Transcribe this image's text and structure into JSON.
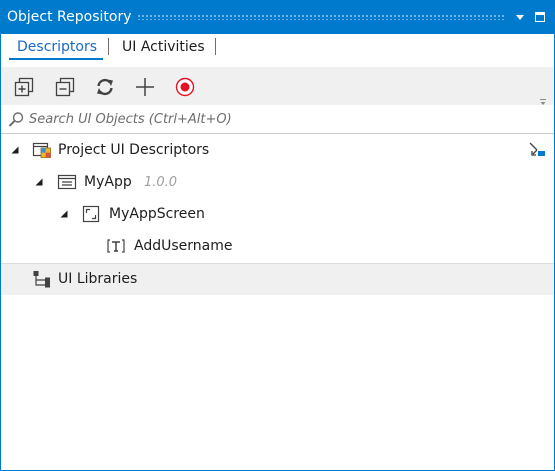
{
  "window": {
    "title": "Object Repository"
  },
  "tabs": [
    {
      "label": "Descriptors",
      "active": true
    },
    {
      "label": "UI Activities",
      "active": false
    }
  ],
  "toolbar": {
    "buttons": [
      {
        "icon": "expand-all-icon"
      },
      {
        "icon": "collapse-all-icon"
      },
      {
        "icon": "refresh-icon"
      },
      {
        "icon": "add-icon"
      },
      {
        "icon": "record-icon"
      }
    ]
  },
  "search": {
    "placeholder": "Search UI Objects (Ctrl+Alt+O)",
    "value": ""
  },
  "tree": {
    "project": {
      "label": "Project UI Descriptors",
      "icon": "project-descriptors-icon",
      "expanded": true
    },
    "app": {
      "label": "MyApp",
      "version": "1.0.0",
      "icon": "application-icon",
      "expanded": true
    },
    "screen": {
      "label": "MyAppScreen",
      "icon": "screen-icon",
      "expanded": true
    },
    "element": {
      "label": "AddUsername",
      "icon": "text-element-icon"
    },
    "libraries": {
      "label": "UI Libraries",
      "icon": "libraries-icon"
    }
  },
  "colors": {
    "accent": "#007acc",
    "record": "#e81123",
    "toolbar_bg": "#f0f0f0"
  }
}
